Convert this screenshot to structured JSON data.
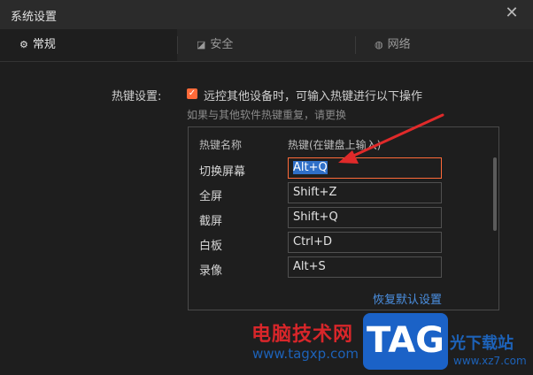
{
  "window": {
    "title": "系统设置",
    "close_icon": "close-icon"
  },
  "tabs": [
    {
      "label": "常规",
      "icon": "gear-icon",
      "active": true
    },
    {
      "label": "安全",
      "icon": "shield-icon",
      "active": false
    },
    {
      "label": "网络",
      "icon": "globe-icon",
      "active": false
    }
  ],
  "hotkey": {
    "section_label": "热键设置:",
    "checkbox_label": "远控其他设备时，可输入热键进行以下操作",
    "checkbox_checked": true,
    "hint": "如果与其他软件热键重复，请更换",
    "col_name": "热键名称",
    "col_key": "热键(在键盘上输入)",
    "rows": [
      {
        "name": "切换屏幕",
        "key": "Alt+Q"
      },
      {
        "name": "全屏",
        "key": "Shift+Z"
      },
      {
        "name": "截屏",
        "key": "Shift+Q"
      },
      {
        "name": "白板",
        "key": "Ctrl+D"
      },
      {
        "name": "录像",
        "key": "Alt+S"
      }
    ],
    "restore_link": "恢复默认设置"
  },
  "colors": {
    "accent": "#ff6a39",
    "link": "#4b90e2",
    "selection": "#2f6fc7",
    "arrow": "#e02a2a"
  },
  "watermark": {
    "site_name": "电脑技术网",
    "url": "www.tagxp.com",
    "logo": "TAG",
    "right_text": "光下载站",
    "right_url": "www.xz7.com"
  }
}
